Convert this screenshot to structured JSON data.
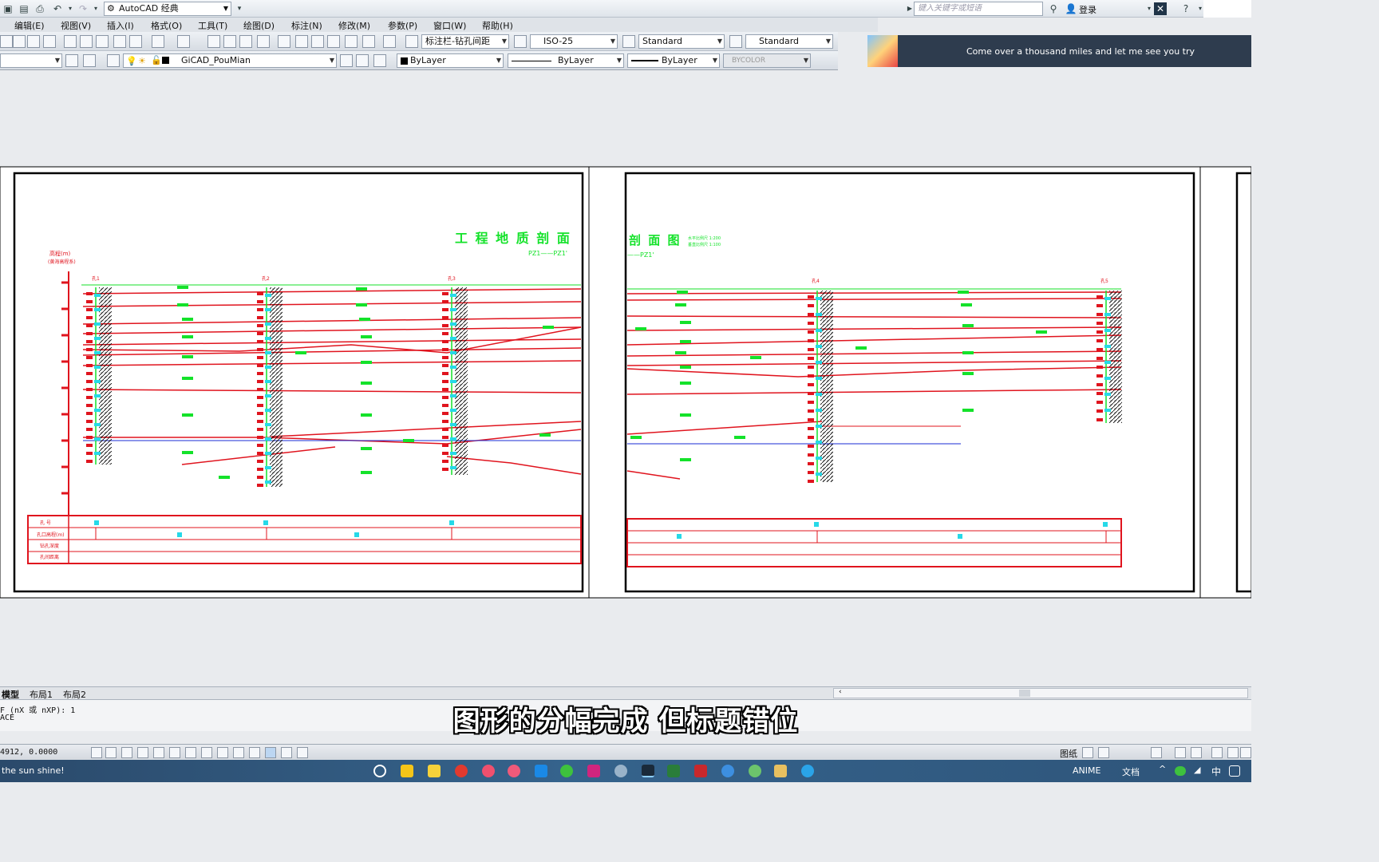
{
  "quick_access": {
    "workspace": "AutoCAD 经典",
    "search_placeholder": "键入关键字或短语",
    "login": "登录"
  },
  "menu": [
    "编辑(E)",
    "视图(V)",
    "插入(I)",
    "格式(O)",
    "工具(T)",
    "绘图(D)",
    "标注(N)",
    "修改(M)",
    "参数(P)",
    "窗口(W)",
    "帮助(H)"
  ],
  "styles": {
    "dim_style_combo": "标注栏-钻孔间距",
    "dim_scale": "ISO-25",
    "text_style": "Standard",
    "table_style": "Standard"
  },
  "layers": {
    "current_layer": "GiCAD_PouMian",
    "color": "ByLayer",
    "linetype": "ByLayer",
    "lineweight": "ByLayer",
    "plot_style": "BYCOLOR"
  },
  "banner": {
    "text": "Come over a thousand miles and let me see you try"
  },
  "drawing": {
    "sheet1": {
      "title": "工 程 地 质 剖 面",
      "subtitle": "PZ1——PZ1'",
      "elevation_label": "高程(m)",
      "elevation_sub": "(黄海高程系)",
      "borehole_labels": [
        "孔1",
        "孔2",
        "孔3"
      ]
    },
    "sheet2": {
      "title": "剖 面 图",
      "subtitle": "——PZ1'",
      "scale_h": "水平比例尺 1:200",
      "scale_v": "垂直比例尺 1:100",
      "borehole_labels": [
        "孔4",
        "孔5"
      ]
    },
    "table_rows": [
      "孔 号",
      "孔口高程(m)",
      "钻孔深度",
      "孔间距离"
    ]
  },
  "layout_tabs": [
    "模型",
    "布局1",
    "布局2"
  ],
  "command": {
    "line1": "F (nX 或 nXP): 1",
    "line2": "ACE"
  },
  "subtitle_caption": "图形的分幅完成 但标题错位",
  "status": {
    "coords": "4912, 0.0000",
    "paper_label": "图纸"
  },
  "taskbar": {
    "media_text": "the sun shine!",
    "anime_label": "ANIME",
    "doc_label": "文档",
    "ime": "中"
  },
  "colors": {
    "geology_red": "#e0141e",
    "label_green": "#14e22a",
    "borehole_cyan": "#26d9e8",
    "groundwater_blue": "#1a2bd6",
    "border_black": "#000000"
  }
}
